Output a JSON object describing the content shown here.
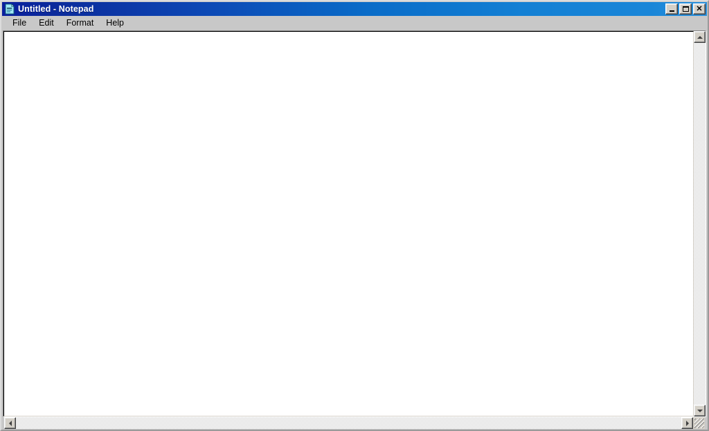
{
  "window": {
    "title": "Untitled - Notepad",
    "app_icon": "notepad-icon",
    "caption_buttons": [
      {
        "name": "minimize",
        "label": "_",
        "tooltip": "Minimize"
      },
      {
        "name": "maximize",
        "label": "□",
        "tooltip": "Maximize"
      },
      {
        "name": "close",
        "label": "✕",
        "tooltip": "Close"
      }
    ],
    "colors": {
      "titlebar_start": "#0a1f9e",
      "titlebar_mid": "#0a6cc8",
      "titlebar_end": "#2a90dc",
      "title_text": "#ffffff",
      "menubar_bg": "#c8c8c8",
      "face": "#d4d0c8",
      "client_bg": "#ffffff"
    }
  },
  "menubar": {
    "items": [
      {
        "label": "File"
      },
      {
        "label": "Edit"
      },
      {
        "label": "Format"
      },
      {
        "label": "Help"
      }
    ]
  },
  "editor": {
    "content": "",
    "placeholder": ""
  },
  "scrollbars": {
    "vertical": {
      "up_arrow": "▲",
      "down_arrow": "▼"
    },
    "horizontal": {
      "left_arrow": "◄",
      "right_arrow": "►"
    },
    "resize_grip": "resize-grip"
  }
}
